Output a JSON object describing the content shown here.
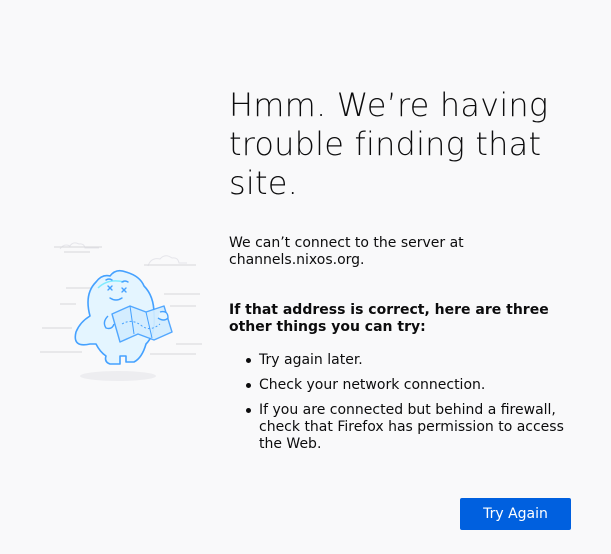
{
  "error": {
    "title": "Hmm. We’re having trouble finding that site.",
    "message": "We can’t connect to the server at channels.nixos.org.",
    "suggest_heading": "If that address is correct, here are three other things you can try:",
    "suggestions": [
      "Try again later.",
      "Check your network connection.",
      "If you are connected but behind a firewall, check that Firefox has permission to access the Web."
    ],
    "try_again_label": "Try Again"
  },
  "colors": {
    "background": "#f9f9fa",
    "primary_button": "#0060df",
    "illustration_outline": "#45a1ff",
    "illustration_fill": "#d3edff"
  },
  "icons": {
    "illustration": "confused-blob-holding-map-illustration"
  }
}
